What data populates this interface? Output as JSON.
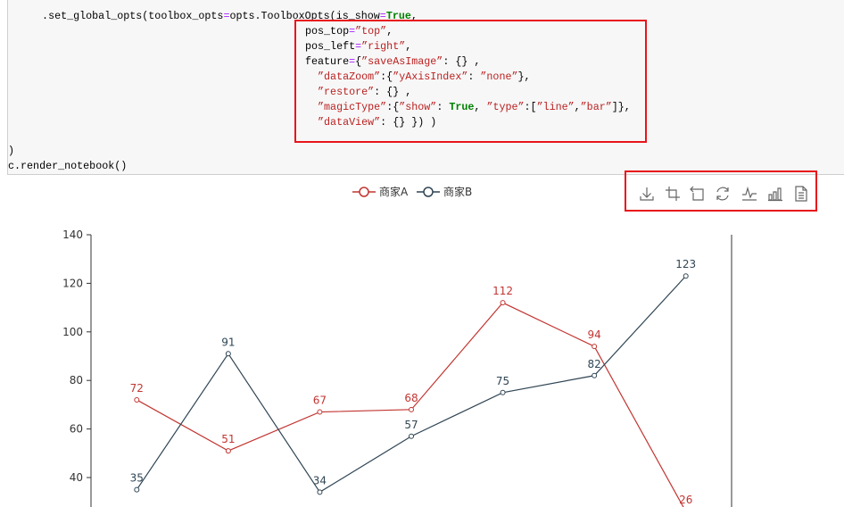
{
  "code": {
    "lines": [
      [
        [
          "    .set_global_opts(toolbox_opts",
          ""
        ],
        [
          "=",
          "op"
        ],
        [
          "opts.ToolboxOpts(is_show",
          ""
        ],
        [
          "=",
          "op"
        ],
        [
          "True",
          "kw"
        ],
        [
          ",",
          ""
        ]
      ],
      [
        [
          "pos_top",
          ""
        ],
        [
          "=",
          "op"
        ],
        [
          "”top”",
          "str"
        ],
        [
          ",",
          ""
        ]
      ],
      [
        [
          "pos_left",
          ""
        ],
        [
          "=",
          "op"
        ],
        [
          "”right”",
          "str"
        ],
        [
          ",",
          ""
        ]
      ],
      [
        [
          "feature",
          ""
        ],
        [
          "=",
          "op"
        ],
        [
          "{",
          ""
        ],
        [
          "”saveAsImage”",
          "str"
        ],
        [
          ": {} ,",
          ""
        ]
      ],
      [
        [
          "  ",
          ""
        ],
        [
          "”dataZoom”",
          "str"
        ],
        [
          ":{",
          ""
        ],
        [
          "”yAxisIndex”",
          "str"
        ],
        [
          ": ",
          ""
        ],
        [
          "”none”",
          "str"
        ],
        [
          "},",
          ""
        ]
      ],
      [
        [
          "  ",
          ""
        ],
        [
          "”restore”",
          "str"
        ],
        [
          ": {} ,",
          ""
        ]
      ],
      [
        [
          "  ",
          ""
        ],
        [
          "”magicType”",
          "str"
        ],
        [
          ":{",
          ""
        ],
        [
          "”show”",
          "str"
        ],
        [
          ": ",
          ""
        ],
        [
          "True",
          "kw"
        ],
        [
          ", ",
          ""
        ],
        [
          "”type”",
          "str"
        ],
        [
          ":[",
          ""
        ],
        [
          "”line”",
          "str"
        ],
        [
          ",",
          ""
        ],
        [
          "”bar”",
          "str"
        ],
        [
          "]},",
          ""
        ]
      ],
      [
        [
          "  ",
          ""
        ],
        [
          "”dataView”",
          "str"
        ],
        [
          ": {} }) )",
          ""
        ]
      ],
      [
        [
          ")",
          ""
        ]
      ],
      [
        [
          "c.render_notebook()",
          ""
        ]
      ]
    ]
  },
  "legend": [
    {
      "label": "商家A",
      "color": "#c23531"
    },
    {
      "label": "商家B",
      "color": "#2f4554"
    }
  ],
  "toolbox": [
    "download-icon",
    "data-zoom-icon",
    "zoom-back-icon",
    "restore-icon",
    "line-chart-icon",
    "bar-chart-icon",
    "data-view-icon"
  ],
  "highlight_color": "#e8141b",
  "chart_data": {
    "type": "line",
    "categories": [
      "",
      "",
      "",
      "",
      "",
      "",
      ""
    ],
    "series": [
      {
        "name": "商家A",
        "values": [
          72,
          51,
          67,
          68,
          112,
          94,
          26
        ],
        "color": "#c23531"
      },
      {
        "name": "商家B",
        "values": [
          35,
          91,
          34,
          57,
          75,
          82,
          123
        ],
        "color": "#2f4554"
      }
    ],
    "yticks": [
      "40",
      "60",
      "80",
      "100",
      "120",
      "140"
    ],
    "ylim": [
      0,
      140
    ],
    "data_labels": true,
    "grid": false,
    "legend": "top-center"
  }
}
